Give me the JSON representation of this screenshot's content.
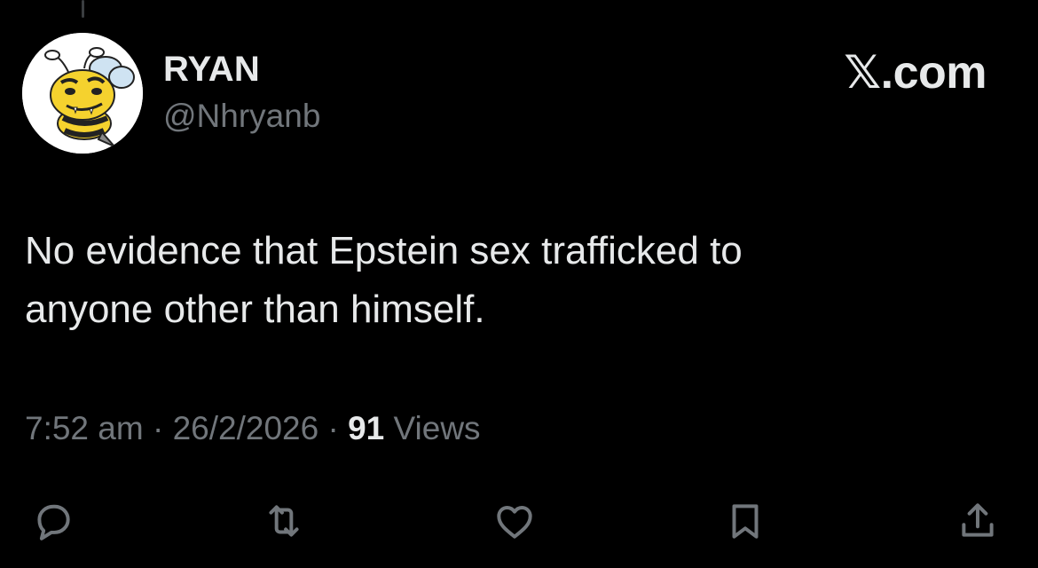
{
  "tweet": {
    "author": {
      "display_name": "RYAN",
      "handle": "@Nhryanb",
      "avatar": "cartoon-bee-avatar"
    },
    "brand": "𝕏.com",
    "text_line1": "No evidence that Epstein sex trafficked to",
    "text_line2": "anyone other than himself.",
    "time": "7:52 am",
    "date": "26/2/2026",
    "views_count": "91",
    "views_label": "Views",
    "separator": "·"
  },
  "actions": [
    {
      "name": "reply",
      "icon": "reply-icon"
    },
    {
      "name": "repost",
      "icon": "repost-icon"
    },
    {
      "name": "like",
      "icon": "heart-icon"
    },
    {
      "name": "bookmark",
      "icon": "bookmark-icon"
    },
    {
      "name": "share",
      "icon": "share-icon"
    }
  ],
  "colors": {
    "background": "#000000",
    "primary_text": "#e7e9ea",
    "secondary_text": "#71767b"
  }
}
